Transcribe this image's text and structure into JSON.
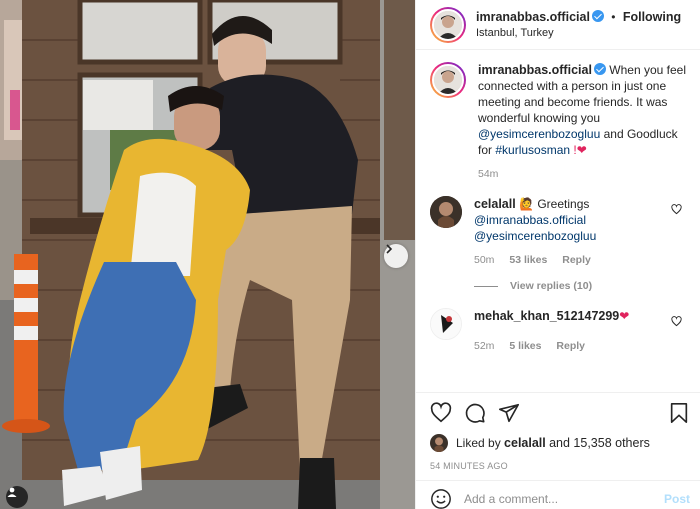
{
  "post": {
    "author": "imranabbas.official",
    "follow_state": "Following",
    "separator": "•",
    "location": "Istanbul, Turkey"
  },
  "caption": {
    "username": "imranabbas.official",
    "text": "When you feel connected with a person in just one meeting and become friends. It was wonderful knowing you",
    "mention": "@yesimcerenbozogluu",
    "middle": "and Goodluck for",
    "hashtag": "#kurlusosman",
    "tail_emoji": "!❤",
    "age": "54m"
  },
  "comments": [
    {
      "username": "celalall",
      "emoji": "🙋",
      "text": "Greetings",
      "mention1": "@imranabbas.official",
      "mention2": "@yesimcerenbozogluu",
      "age": "50m",
      "likes": "53 likes",
      "reply": "Reply",
      "view_replies": "View replies (10)"
    },
    {
      "username": "mehak_khan_512147299",
      "emoji": "❤",
      "age": "52m",
      "likes": "5 likes",
      "reply": "Reply"
    }
  ],
  "actions": {
    "liked_by_prefix": "Liked by",
    "liked_by_user": "celalall",
    "liked_by_suffix": "and 15,358 others",
    "timestamp": "54 MINUTES AGO"
  },
  "composer": {
    "placeholder": "Add a comment...",
    "post_label": "Post"
  },
  "colors": {
    "link": "#00376b",
    "verified": "#3897f0",
    "muted": "#8e8e8e",
    "post_disabled": "#b2dffc"
  },
  "icons": [
    "heart-icon",
    "comment-icon",
    "share-icon",
    "bookmark-icon",
    "smiley-icon",
    "chevron-right-icon",
    "verified-badge-icon",
    "tag-user-icon"
  ]
}
